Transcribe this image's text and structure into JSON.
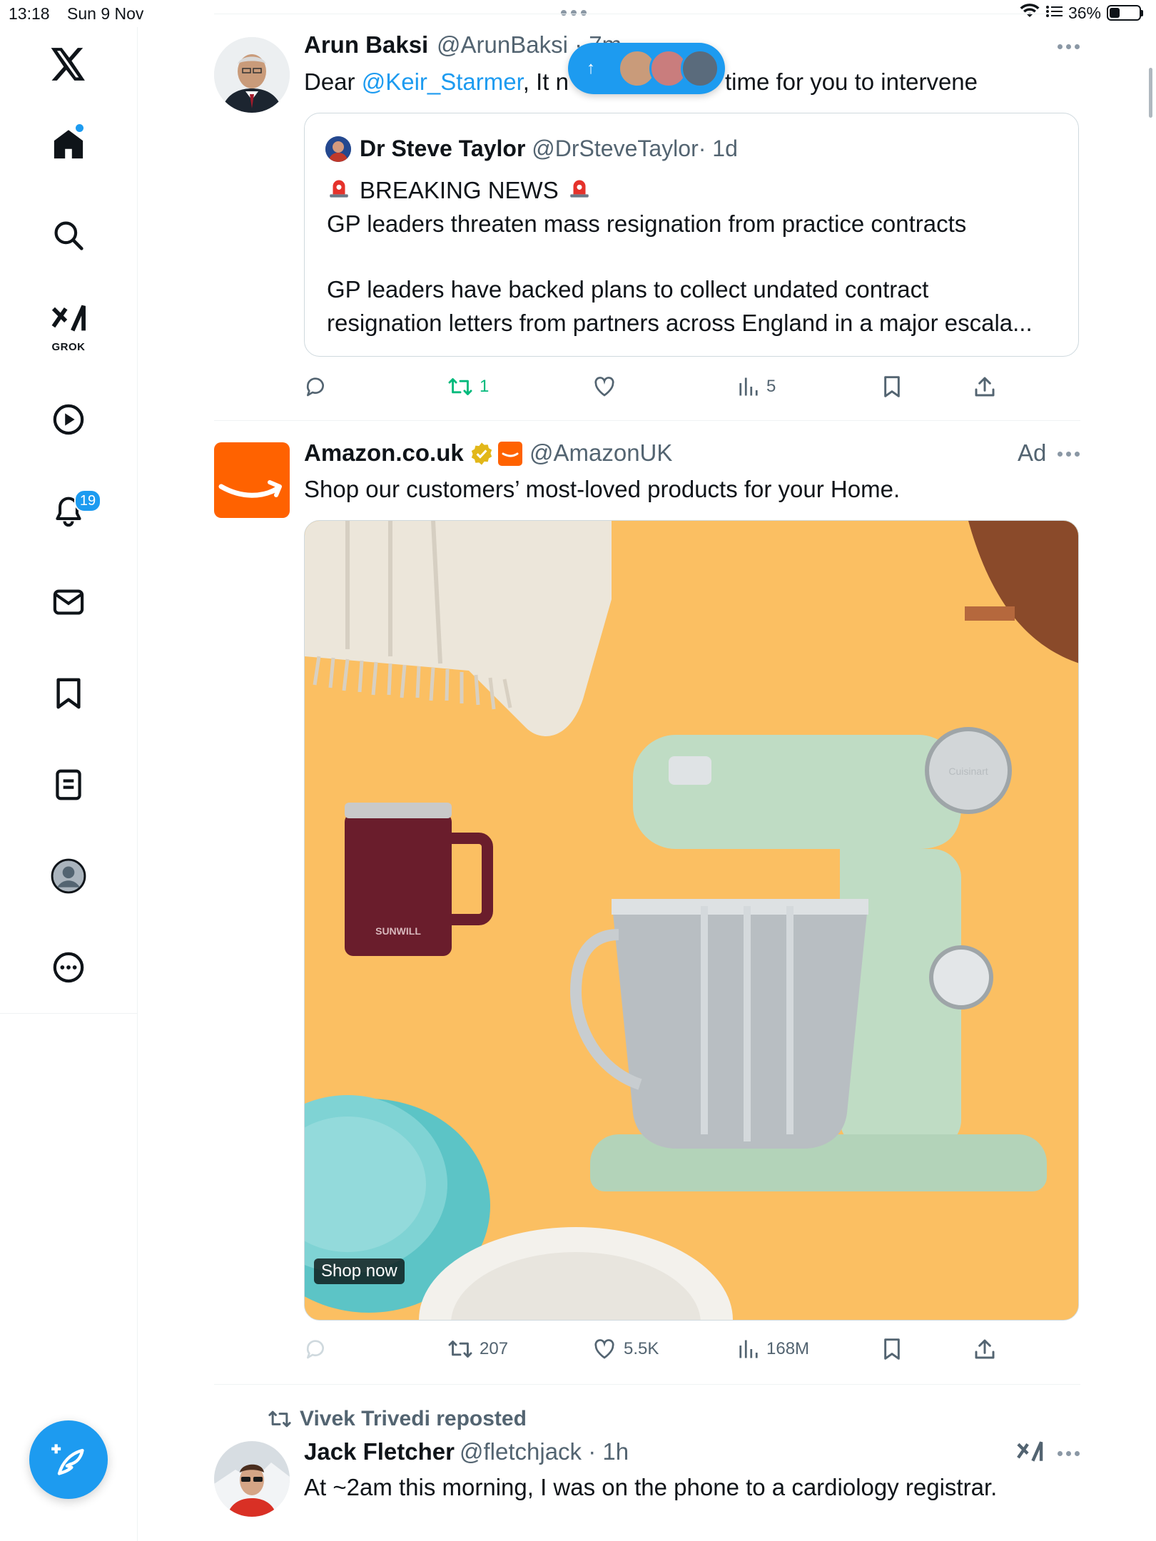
{
  "status_bar": {
    "time": "13:18",
    "date": "Sun 9 Nov",
    "battery": "36%",
    "battery_level": 0.36
  },
  "sidebar": {
    "grok_label": "GROK",
    "notifications_badge": "19"
  },
  "new_posts_pill": {
    "arrow": "↑"
  },
  "tweets": [
    {
      "name": "Arun Baksi",
      "handle": "@ArunBaksi",
      "time_fragment": "· 7m",
      "text_prefix": "Dear",
      "mention": "@Keir_Starmer",
      "text_mid": ", It n",
      "text_suffix": "time for you to intervene",
      "quote": {
        "name": "Dr Steve Taylor",
        "handle": "@DrSteveTaylor",
        "time": "· 1d",
        "headline": "BREAKING NEWS",
        "line1": "GP leaders threaten mass resignation from practice contracts",
        "line2": "GP leaders have backed plans to collect undated contract",
        "line3": "resignation letters from partners across England in a major escala..."
      },
      "actions": {
        "reposts": "1",
        "views": "5"
      }
    },
    {
      "name": "Amazon.co.uk",
      "handle": "@AmazonUK",
      "ad_label": "Ad",
      "text": "Shop our customers’ most-loved products for your Home.",
      "media": {
        "cta": "Shop now",
        "mug_brand": "SUNWILL",
        "mixer_brand": "Cuisinart"
      },
      "actions": {
        "reposts": "207",
        "likes": "5.5K",
        "views": "168M"
      }
    },
    {
      "repost_banner": "Vivek Trivedi reposted",
      "name": "Jack Fletcher",
      "handle": "@fletchjack",
      "time": "· 1h",
      "text": "At ~2am this morning, I was on the phone to a cardiology registrar."
    }
  ],
  "colors": {
    "accent": "#1d9bf0",
    "repost_green": "#00ba7c",
    "amazon_orange": "#ff6200",
    "ad_background": "#fbbf62"
  }
}
